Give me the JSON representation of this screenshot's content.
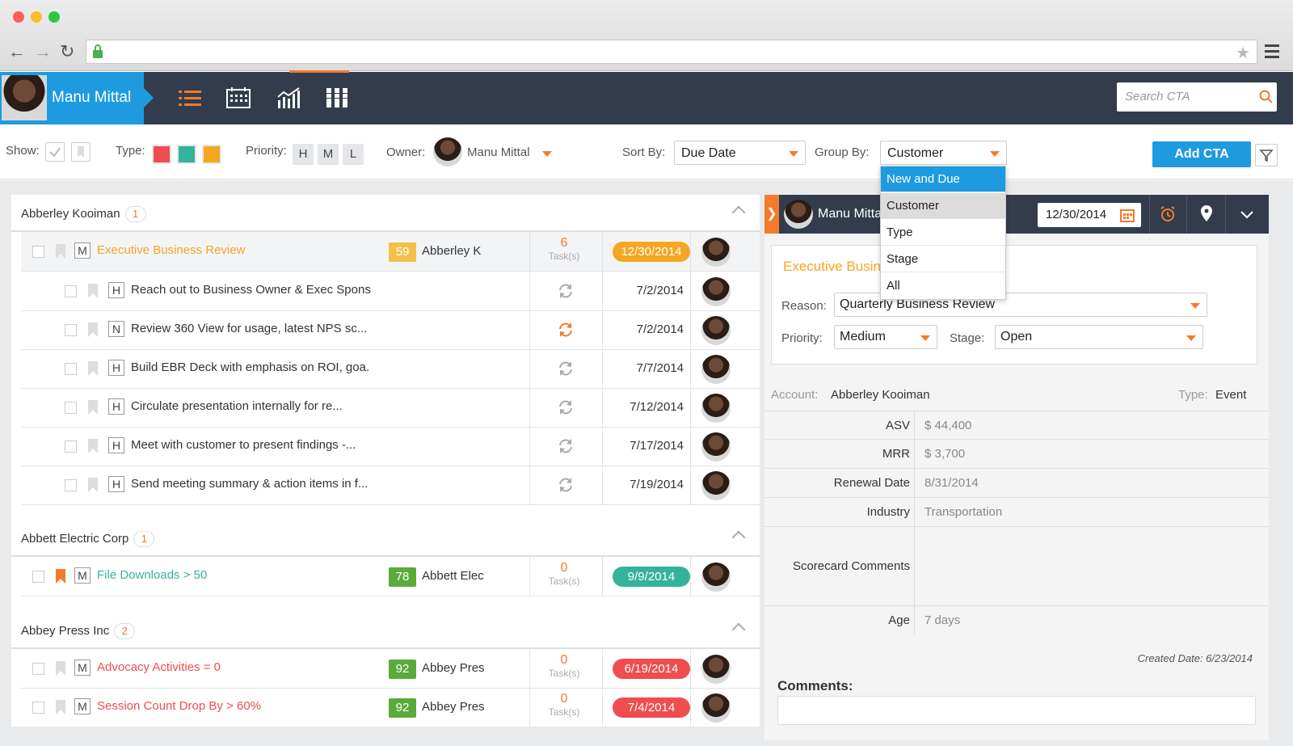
{
  "header": {
    "user_name": "Manu Mittal",
    "search_placeholder": "Search CTA"
  },
  "filters": {
    "show_label": "Show:",
    "type_label": "Type:",
    "type_colors": [
      "#ef4d4f",
      "#35b39a",
      "#f5a623"
    ],
    "priority_label": "Priority:",
    "priority_options": [
      "H",
      "M",
      "L"
    ],
    "owner_label": "Owner:",
    "owner_name": "Manu Mittal",
    "sort_label": "Sort By:",
    "sort_value": "Due Date",
    "group_label": "Group By:",
    "group_value": "Customer",
    "add_button": "Add CTA"
  },
  "group_by_menu": {
    "items": [
      "New and Due",
      "Customer",
      "Type",
      "Stage",
      "All"
    ],
    "highlighted": "New and Due",
    "selected": "Customer"
  },
  "groups": [
    {
      "name": "Abberley Kooiman",
      "count": "1",
      "cta": {
        "priority": "M",
        "title": "Executive Business Review",
        "title_color": "#f5a623",
        "score": "59",
        "score_color": "#f5c04a",
        "account": "Abberley K",
        "tasks": "6",
        "tasks_label": "Task(s)",
        "due": "12/30/2014",
        "due_color": "#f5a623"
      },
      "tasks": [
        {
          "priority": "H",
          "title": "Reach out to Business Owner & Exec Spons",
          "due": "7/2/2014"
        },
        {
          "priority": "N",
          "title": "Review 360 View for usage, latest NPS sc...",
          "due": "7/2/2014"
        },
        {
          "priority": "H",
          "title": "Build EBR Deck with emphasis on ROI, goa.",
          "due": "7/7/2014"
        },
        {
          "priority": "H",
          "title": "Circulate presentation internally for re...",
          "due": "7/12/2014"
        },
        {
          "priority": "H",
          "title": "Meet with customer to present findings -...",
          "due": "7/17/2014"
        },
        {
          "priority": "H",
          "title": "Send meeting summary & action items in f...",
          "due": "7/19/2014"
        }
      ]
    },
    {
      "name": "Abbett Electric Corp",
      "count": "1",
      "cta": {
        "priority": "M",
        "title": "File Downloads > 50",
        "title_color": "#35b39a",
        "score": "78",
        "score_color": "#5aab3a",
        "account": "Abbett Elec",
        "tasks": "0",
        "tasks_label": "Task(s)",
        "due": "9/9/2014",
        "due_color": "#35b39a"
      }
    },
    {
      "name": "Abbey Press Inc",
      "count": "2",
      "ctas": [
        {
          "priority": "M",
          "title": "Advocacy Activities = 0",
          "title_color": "#ef4d4f",
          "score": "92",
          "score_color": "#5aab3a",
          "account": "Abbey Pres",
          "tasks": "0",
          "tasks_label": "Task(s)",
          "due": "6/19/2014",
          "due_color": "#ef4d4f"
        },
        {
          "priority": "M",
          "title": "Session Count Drop By > 60%",
          "title_color": "#ef4d4f",
          "score": "92",
          "score_color": "#5aab3a",
          "account": "Abbey Pres",
          "tasks": "0",
          "tasks_label": "Task(s)",
          "due": "7/4/2014",
          "due_color": "#ef4d4f"
        }
      ]
    }
  ],
  "detail": {
    "owner": "Manu Mittal",
    "due_date": "12/30/2014",
    "title": "Executive Business Review",
    "reason_label": "Reason:",
    "reason_value": "Quarterly Business Review",
    "priority_label": "Priority:",
    "priority_value": "Medium",
    "stage_label": "Stage:",
    "stage_value": "Open",
    "account_label": "Account:",
    "account_value": "Abberley Kooiman",
    "type_label": "Type:",
    "type_value": "Event",
    "fields": [
      {
        "label": "ASV",
        "value": "$ 44,400"
      },
      {
        "label": "MRR",
        "value": "$ 3,700"
      },
      {
        "label": "Renewal Date",
        "value": "8/31/2014"
      },
      {
        "label": "Industry",
        "value": "Transportation"
      },
      {
        "label": "Scorecard Comments",
        "value": ""
      },
      {
        "label": "Age",
        "value": "7 days"
      }
    ],
    "created_date": "Created Date: 6/23/2014",
    "comments_label": "Comments:"
  }
}
